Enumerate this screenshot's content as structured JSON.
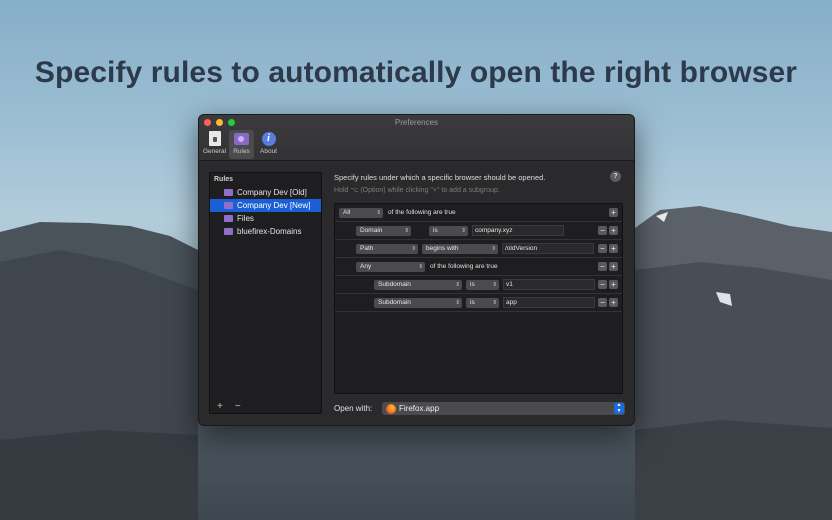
{
  "headline": "Specify rules to automatically open the right browser",
  "window": {
    "title": "Preferences",
    "toolbar": [
      {
        "label": "General",
        "icon": "general-icon"
      },
      {
        "label": "Rules",
        "icon": "rules-icon"
      },
      {
        "label": "About",
        "icon": "info-icon"
      }
    ]
  },
  "sidebar": {
    "header": "Rules",
    "items": [
      {
        "label": "Company Dev [Old]"
      },
      {
        "label": "Company Dev [New]",
        "selected": true
      },
      {
        "label": "Files"
      },
      {
        "label": "bluefirex-Domains"
      }
    ],
    "add": "+",
    "remove": "−"
  },
  "description": {
    "line1": "Specify rules under which a specific browser should be opened.",
    "line2": "Hold ⌥ (Option) while clicking \"+\" to add a subgroup.",
    "help": "?"
  },
  "rules": {
    "root": {
      "match": "All",
      "suffix": "of the following are true"
    },
    "row1": {
      "field": "Domain",
      "op": "is",
      "value": "company.xyz"
    },
    "row2": {
      "field": "Path",
      "op": "begins with",
      "value": "/oldVersion"
    },
    "group": {
      "match": "Any",
      "suffix": "of the following are true"
    },
    "row3": {
      "field": "Subdomain",
      "op": "is",
      "value": "v1"
    },
    "row4": {
      "field": "Subdomain",
      "op": "is",
      "value": "app"
    },
    "plus": "+",
    "minus": "−"
  },
  "open_with": {
    "label": "Open with:",
    "browser": "Firefox.app"
  },
  "colors": {
    "accent": "#1b5fd6",
    "folder": "#8e6fc9"
  }
}
